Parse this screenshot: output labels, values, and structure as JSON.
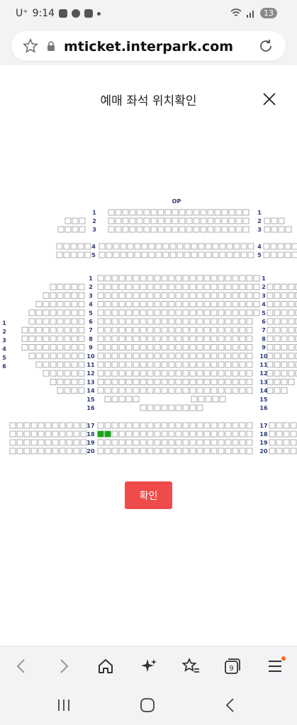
{
  "status_bar": {
    "carrier": "U⁺",
    "time": "9:14",
    "battery": "13"
  },
  "browser": {
    "url": "mticket.interpark.com"
  },
  "dialog": {
    "title": "예매 좌석 위치확인",
    "confirm_label": "확인"
  },
  "seat_map": {
    "stage_label": "OP",
    "upper_rows": [
      "1",
      "2",
      "3",
      "4",
      "5"
    ],
    "main_rows": [
      "1",
      "2",
      "3",
      "4",
      "5",
      "6",
      "7",
      "8",
      "9",
      "10",
      "11",
      "12",
      "13",
      "14",
      "15",
      "16"
    ],
    "side_rows": [
      "1",
      "2",
      "3",
      "4",
      "5",
      "6"
    ],
    "lower_rows": [
      "17",
      "18",
      "19",
      "20"
    ],
    "selected_seat_row": "18",
    "selected_seat_count": 2
  },
  "colors": {
    "accent": "#ef4b4b",
    "selected_seat": "#1aa31a",
    "row_label": "#2a3a78"
  },
  "icons": [
    "star-icon",
    "lock-icon",
    "reload-icon",
    "close-icon",
    "back-icon",
    "forward-icon",
    "home-icon",
    "sparkle-icon",
    "bookmarks-icon",
    "tabs-icon",
    "menu-icon",
    "recent-apps-icon",
    "nav-home-icon",
    "nav-back-icon"
  ],
  "toolbar": {
    "tabs_count": "9"
  }
}
